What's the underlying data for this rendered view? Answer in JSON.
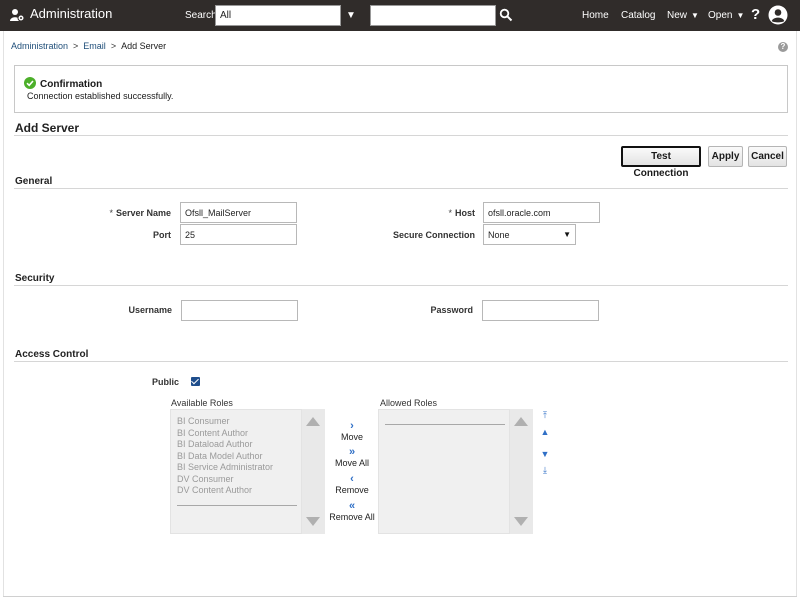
{
  "topbar": {
    "app_title": "Administration",
    "search_label": "Search",
    "search_scope": "All",
    "search_placeholder": "",
    "nav_home": "Home",
    "nav_catalog": "Catalog",
    "nav_new": "New",
    "nav_open": "Open",
    "help": "?"
  },
  "breadcrumb": {
    "items": [
      "Administration",
      "Email",
      "Add Server"
    ],
    "separator": ">"
  },
  "confirmation": {
    "title": "Confirmation",
    "message": "Connection established successfully."
  },
  "page_title": "Add Server",
  "actions": {
    "test_connection": "Test Connection",
    "apply": "Apply",
    "cancel": "Cancel"
  },
  "general": {
    "title": "General",
    "server_name_label": "Server Name",
    "server_name_value": "Ofsll_MailServer",
    "host_label": "Host",
    "host_value": "ofsll.oracle.com",
    "port_label": "Port",
    "port_value": "25",
    "secure_label": "Secure Connection",
    "secure_value": "None",
    "required_marker": "*"
  },
  "security": {
    "title": "Security",
    "username_label": "Username",
    "username_value": "",
    "password_label": "Password",
    "password_value": ""
  },
  "access": {
    "title": "Access Control",
    "public_label": "Public",
    "public_checked": true,
    "available_label": "Available Roles",
    "available_roles": [
      "BI Consumer",
      "BI Content Author",
      "BI Dataload Author",
      "BI Data Model Author",
      "BI Service Administrator",
      "DV Consumer",
      "DV Content Author"
    ],
    "allowed_label": "Allowed Roles",
    "allowed_roles": [],
    "move": "Move",
    "move_all": "Move All",
    "remove": "Remove",
    "remove_all": "Remove All"
  },
  "colors": {
    "topbar_bg": "#302c2a",
    "link": "#1f4e79",
    "success": "#4caf2a",
    "shuttle_arrow": "#2f6fc6"
  }
}
